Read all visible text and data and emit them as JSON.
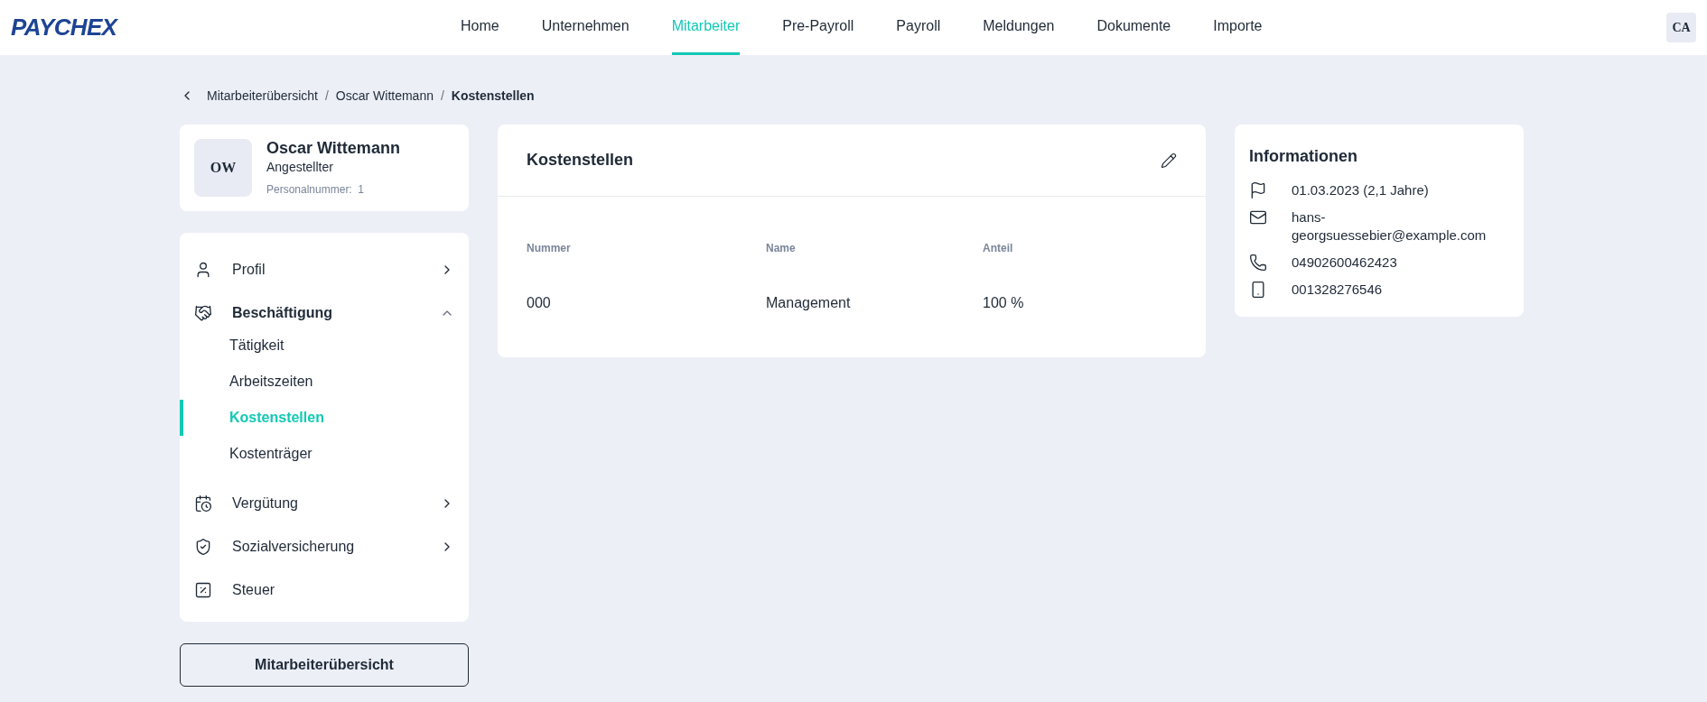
{
  "header": {
    "logo": "PAYCHEX",
    "nav": [
      {
        "label": "Home",
        "selected": false
      },
      {
        "label": "Unternehmen",
        "selected": false
      },
      {
        "label": "Mitarbeiter",
        "selected": true
      },
      {
        "label": "Pre-Payroll",
        "selected": false
      },
      {
        "label": "Payroll",
        "selected": false
      },
      {
        "label": "Meldungen",
        "selected": false
      },
      {
        "label": "Dokumente",
        "selected": false
      },
      {
        "label": "Importe",
        "selected": false
      }
    ],
    "user_initials": "CA"
  },
  "breadcrumb": {
    "separator": "/",
    "items": [
      "Mitarbeiterübersicht",
      "Oscar Wittemann",
      "Kostenstellen"
    ]
  },
  "profile": {
    "initials": "OW",
    "name": "Oscar Wittemann",
    "role": "Angestellter",
    "personnel_number": "Personalnummer:  1"
  },
  "sidebar": {
    "items": [
      {
        "label": "Profil",
        "kind": "group",
        "expanded": false
      },
      {
        "label": "Beschäftigung",
        "kind": "group",
        "expanded": true,
        "children": [
          {
            "label": "Tätigkeit",
            "selected": false
          },
          {
            "label": "Arbeitszeiten",
            "selected": false
          },
          {
            "label": "Kostenstellen",
            "selected": true
          },
          {
            "label": "Kostenträger",
            "selected": false
          }
        ]
      },
      {
        "label": "Vergütung",
        "kind": "group",
        "expanded": false
      },
      {
        "label": "Sozialversicherung",
        "kind": "group",
        "expanded": false
      },
      {
        "label": "Steuer",
        "kind": "link"
      }
    ],
    "button": "Mitarbeiterübersicht"
  },
  "card": {
    "title": "Kostenstellen",
    "table": {
      "columns": [
        "Nummer",
        "Name",
        "Anteil"
      ],
      "rows": [
        [
          "000",
          "Management",
          "100 %"
        ]
      ]
    }
  },
  "info": {
    "title": "Informationen",
    "items": [
      "01.03.2023 (2,1 Jahre)",
      "hans-georgsuessebier@example.com",
      "04902600462423",
      "001328276546"
    ]
  }
}
